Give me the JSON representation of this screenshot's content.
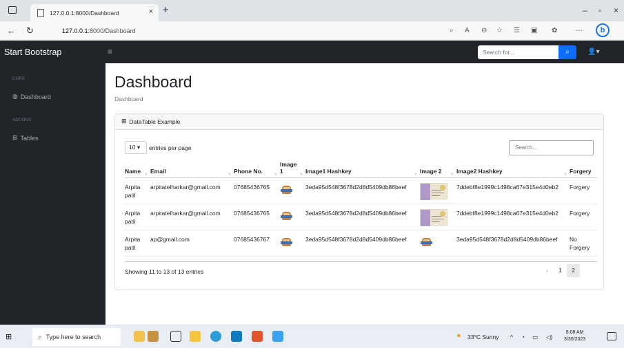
{
  "browser": {
    "tab_title": "127.0.0.1:8000/Dashboard",
    "url_host": "127.0.0.1:",
    "url_path": "8000/Dashboard"
  },
  "topnav": {
    "brand": "Start Bootstrap",
    "search_placeholder": "Search for..."
  },
  "sidebar": {
    "core_heading": "CORE",
    "dashboard_label": "Dashboard",
    "addons_heading": "ADDONS",
    "tables_label": "Tables"
  },
  "page": {
    "title": "Dashboard",
    "breadcrumb": "Dashboard"
  },
  "card": {
    "header": "DataTable Example",
    "per_page_value": "10",
    "per_page_label": "entries per page",
    "search_placeholder": "Search...",
    "columns": [
      "Name",
      "Email",
      "Phone No.",
      "Image 1",
      "Image1 Hashkey",
      "Image 2",
      "Image2 Hashkey",
      "Forgery"
    ],
    "rows": [
      {
        "name": "Arpita patil",
        "email": "arpitatelharkar@gmail.com",
        "phone": "07685436765",
        "image1": "signature-thumbnail",
        "hash1": "3eda95d548f3678d2d8d5409db86beef",
        "image2": "document-thumbnail",
        "hash2": "7ddebf8e1999c1498ca67e315e4d0eb2",
        "forgery": "Forgery"
      },
      {
        "name": "Arpita patil",
        "email": "arpitatelharkar@gmail.com",
        "phone": "07685436765",
        "image1": "signature-thumbnail",
        "hash1": "3eda95d548f3678d2d8d5409db86beef",
        "image2": "document-thumbnail",
        "hash2": "7ddebf8e1999c1498ca67e315e4d0eb2",
        "forgery": "Forgery"
      },
      {
        "name": "Arpita patil",
        "email": "ap@gmail.com",
        "phone": "07685436767",
        "image1": "signature-thumbnail",
        "hash1": "3eda95d548f3678d2d8d5409db86beef",
        "image2": "signature-thumbnail",
        "hash2": "3eda95d548f3678d2d8d5409db86beef",
        "forgery": "No Forgery"
      }
    ],
    "info": "Showing 11 to 13 of 13 entries",
    "pager": {
      "prev": "‹",
      "pages": [
        "1",
        "2"
      ],
      "active_page": "2"
    }
  },
  "taskbar": {
    "search_placeholder": "Type here to search",
    "weather": "33°C  Sunny",
    "time": "8:08 AM",
    "date": "3/30/2023"
  },
  "colors": {
    "nav_dark": "#212529",
    "primary": "#0d6efd"
  }
}
